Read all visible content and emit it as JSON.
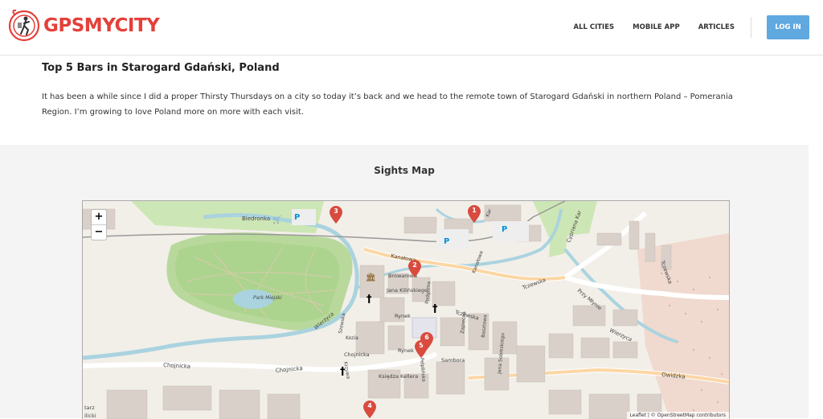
{
  "brand": {
    "name": "GPSMYCITY",
    "accent": "#e4403a"
  },
  "nav": {
    "links": [
      {
        "label": "ALL CITIES"
      },
      {
        "label": "MOBILE APP"
      },
      {
        "label": "ARTICLES"
      }
    ],
    "login_label": "LOG IN",
    "login_color": "#5fa8e0"
  },
  "article": {
    "title": "Top 5 Bars in Starogard Gdański, Poland",
    "intro": "It has been a while since I did a proper Thirsty Thursdays on a city so today it’s back and we head to the remote town of Starogard Gdański in northern Poland – Pomerania Region. I’m growing to love Poland more on more with each visit."
  },
  "map": {
    "heading": "Sights Map",
    "zoom_in": "+",
    "zoom_out": "−",
    "attribution": "Leaflet | © OpenStreetMap contributors",
    "markers": [
      "1",
      "2",
      "3",
      "4",
      "5",
      "6"
    ],
    "labels": {
      "biedronka": "Biedronka",
      "park": "Park Miejski",
      "kanalowa": "Kanałowa",
      "browarowa": "Browarowa",
      "kilinskiego": "Jana Kilińskiego",
      "rynek1": "Rynek",
      "rynek2": "Rynek",
      "chojnicka1": "Chojnicka",
      "chojnicka2": "Chojnicka",
      "chojnicka3": "Chojnicka",
      "kellera": "Księdza Kellera",
      "sambora": "Sambora",
      "tczewska1": "Tczewska",
      "tczewska2": "Tczewska",
      "tczewska3": "Tczewska",
      "owidzka": "Owidzka",
      "wierzyca1": "Wierzyca",
      "wierzyca2": "Wierzyca",
      "przymlynie": "Przy Młynie",
      "cyprianakat": "Cypriana Kar",
      "kozia": "Kozia",
      "szewska": "Szewska",
      "krzywa": "Krzywa",
      "zapiecna": "Zapiecna",
      "basztowa": "Basztowa",
      "sobieskiego": "Jana Sobieskiego",
      "podgorna": "Podgórna",
      "pelplinska": "Pelplińska",
      "kanalowa2": "Kanałowa",
      "starz": "tarz",
      "dlicki": "ilicki",
      "kar": "Kar"
    }
  }
}
